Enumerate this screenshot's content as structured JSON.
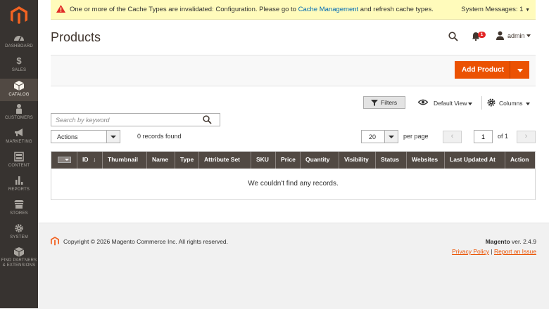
{
  "sidebar": {
    "logo": "magento-logo-icon",
    "items": [
      {
        "label": "DASHBOARD",
        "icon": "speedometer-icon"
      },
      {
        "label": "SALES",
        "icon": "dollar-icon"
      },
      {
        "label": "CATALOG",
        "icon": "cube-icon"
      },
      {
        "label": "CUSTOMERS",
        "icon": "person-icon"
      },
      {
        "label": "MARKETING",
        "icon": "megaphone-icon"
      },
      {
        "label": "CONTENT",
        "icon": "layout-icon"
      },
      {
        "label": "REPORTS",
        "icon": "bar-chart-icon"
      },
      {
        "label": "STORES",
        "icon": "storefront-icon"
      },
      {
        "label": "SYSTEM",
        "icon": "gear-icon"
      },
      {
        "label1": "FIND PARTNERS",
        "label2": "& EXTENSIONS",
        "icon": "box-icon"
      }
    ],
    "active_index": 2,
    "colors": {
      "bg": "#373330",
      "active_bg": "#514943"
    }
  },
  "system_message": {
    "prefix": "One or more of the Cache Types are invalidated: Configuration. Please go to ",
    "link": "Cache Management",
    "suffix": " and refresh cache types.",
    "counter": "System Messages: 1",
    "icon": "warning-icon"
  },
  "header": {
    "title": "Products",
    "notification_count": "1",
    "username": "admin"
  },
  "add_product": {
    "label": "Add Product",
    "color": "#eb5202"
  },
  "toolbar": {
    "filters_label": "Filters",
    "view_label": "Default View",
    "columns_label": "Columns",
    "search_placeholder": "Search by keyword",
    "actions_label": "Actions",
    "records_found": "0 records found",
    "per_page_value": "20",
    "per_page_label": "per page",
    "page_current": "1",
    "page_of": "of 1",
    "prev": "‹",
    "next": "›"
  },
  "grid": {
    "columns": [
      "ID",
      "Thumbnail",
      "Name",
      "Type",
      "Attribute Set",
      "SKU",
      "Price",
      "Quantity",
      "Visibility",
      "Status",
      "Websites",
      "Last Updated At",
      "Action"
    ],
    "sort_indicator": "↓",
    "empty_message": "We couldn't find any records."
  },
  "footer": {
    "copyright": "Copyright © 2026 Magento Commerce Inc. All rights reserved.",
    "brand": "Magento",
    "version": " ver. 2.4.9",
    "privacy": "Privacy Policy",
    "separator": "|",
    "report": "Report an Issue"
  }
}
